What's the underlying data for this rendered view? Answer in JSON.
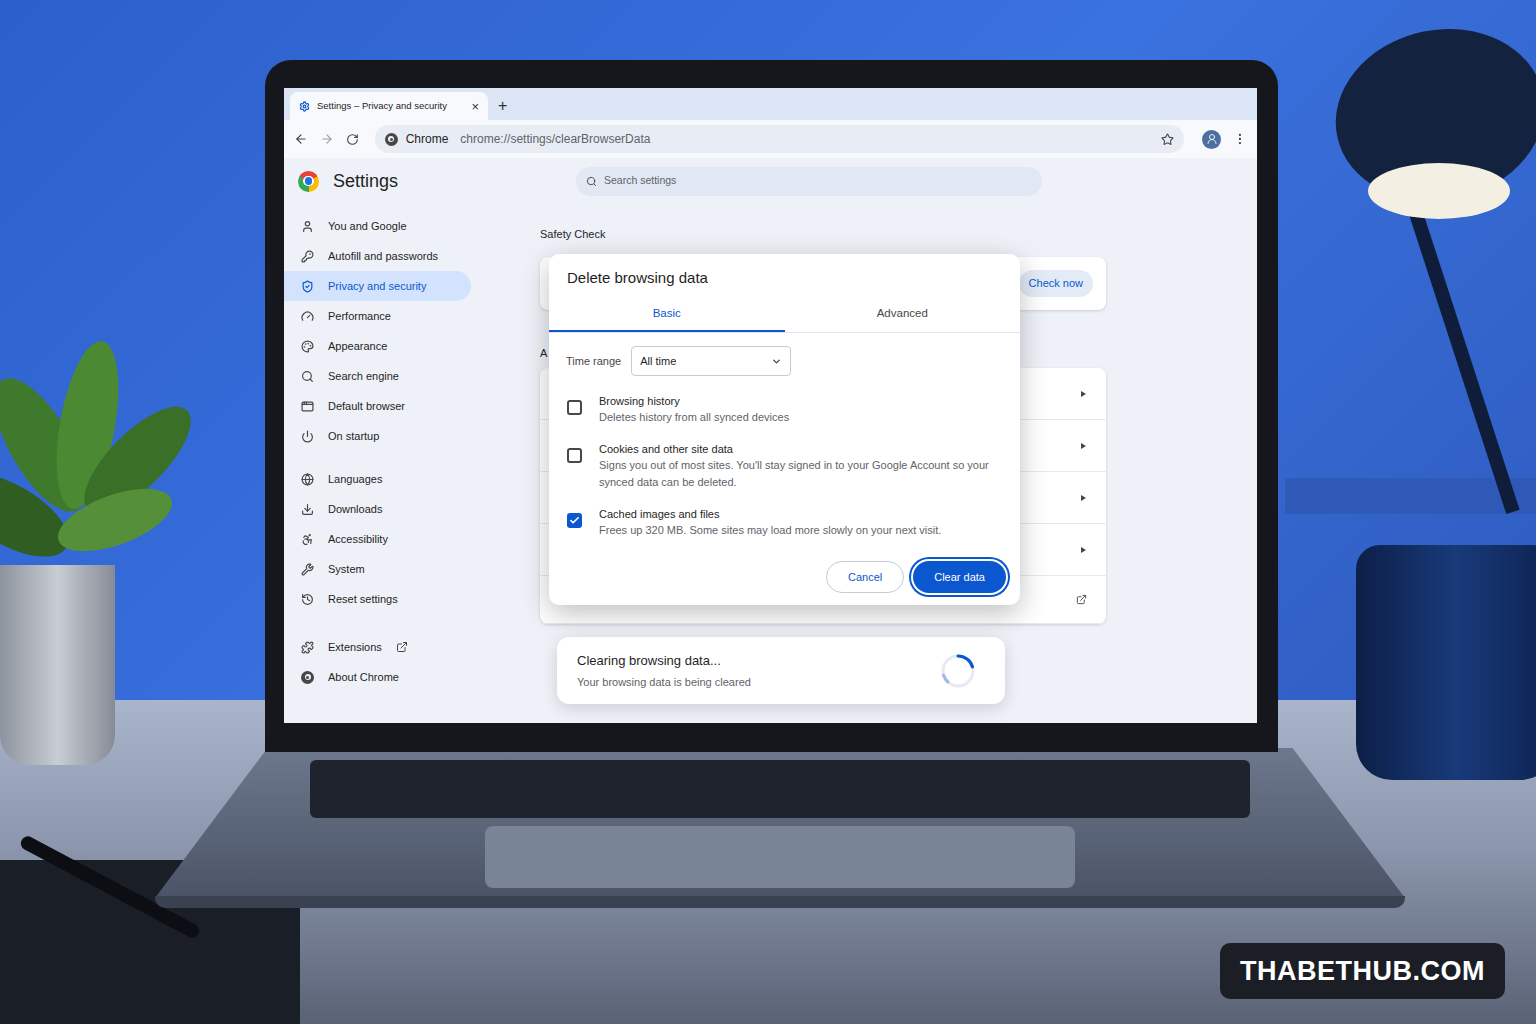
{
  "browser": {
    "tab": {
      "title": "Settings – Privacy and security",
      "close": "×"
    },
    "new_tab": "+",
    "omnibox": {
      "site": "Chrome",
      "url": "chrome://settings/clearBrowserData"
    }
  },
  "settings": {
    "title": "Settings",
    "search_placeholder": "Search settings",
    "sidebar": {
      "groups": [
        [
          {
            "label": "You and Google",
            "selected": false,
            "kind": "page"
          },
          {
            "label": "Autofill and passwords",
            "selected": false,
            "kind": "page"
          },
          {
            "label": "Privacy and security",
            "selected": true,
            "kind": "page"
          },
          {
            "label": "Performance",
            "selected": false,
            "kind": "page"
          },
          {
            "label": "Appearance",
            "selected": false,
            "kind": "page"
          },
          {
            "label": "Search engine",
            "selected": false,
            "kind": "page"
          },
          {
            "label": "Default browser",
            "selected": false,
            "kind": "page"
          },
          {
            "label": "On startup",
            "selected": false,
            "kind": "page"
          }
        ],
        [
          {
            "label": "Languages",
            "selected": false,
            "kind": "page"
          },
          {
            "label": "Downloads",
            "selected": false,
            "kind": "page"
          },
          {
            "label": "Accessibility",
            "selected": false,
            "kind": "page"
          },
          {
            "label": "System",
            "selected": false,
            "kind": "page"
          },
          {
            "label": "Reset settings",
            "selected": false,
            "kind": "page"
          }
        ],
        [
          {
            "label": "Extensions",
            "selected": false,
            "kind": "external"
          },
          {
            "label": "About Chrome",
            "selected": false,
            "kind": "page"
          }
        ]
      ]
    }
  },
  "main": {
    "safety_check": {
      "label": "Safety Check",
      "button": "Check now"
    },
    "section_label": "A",
    "rows": [
      {
        "kind": "arrow"
      },
      {
        "kind": "arrow"
      },
      {
        "kind": "arrow"
      },
      {
        "kind": "arrow"
      },
      {
        "kind": "external"
      }
    ]
  },
  "dialog": {
    "title": "Delete browsing data",
    "tabs": [
      {
        "label": "Basic",
        "selected": true
      },
      {
        "label": "Advanced",
        "selected": false
      }
    ],
    "time_range": {
      "label": "Time range",
      "value": "All time"
    },
    "options": [
      {
        "label": "Browsing history",
        "description": "Deletes history from all synced devices",
        "checked": false
      },
      {
        "label": "Cookies and other site data",
        "description": "Signs you out of most sites. You'll stay signed in to your Google Account so your synced data can be deleted.",
        "checked": false
      },
      {
        "label": "Cached images and files",
        "description": "Frees up 320 MB. Some sites may load more slowly on your next visit.",
        "checked": true
      }
    ],
    "buttons": [
      {
        "label": "Cancel",
        "primary": false,
        "focused": false
      },
      {
        "label": "Clear data",
        "primary": true,
        "focused": true
      }
    ]
  },
  "toast": {
    "title": "Clearing browsing data...",
    "message": "Your browsing data is being cleared"
  },
  "watermark": "THABETHUB.COM"
}
